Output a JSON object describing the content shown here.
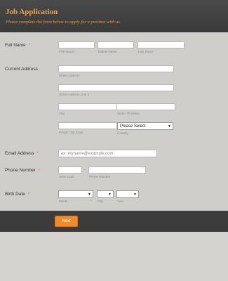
{
  "header": {
    "title": "Job Application",
    "subtitle": "Please complete the form below to apply for a position with us."
  },
  "full_name": {
    "label": "Full Name",
    "required_mark": "*",
    "first_sub": "First Name",
    "middle_sub": "Middle Name",
    "last_sub": "Last Name"
  },
  "address": {
    "label": "Current Address",
    "street_sub": "Street Address",
    "street2_sub": "Street Address Line 2",
    "city_sub": "City",
    "state_sub": "State / Province",
    "postal_sub": "Postal / Zip Code",
    "country_sub": "Country",
    "country_value": "Please Select"
  },
  "email": {
    "label": "Email Address",
    "required_mark": "*",
    "placeholder": "ex: myname@example.com"
  },
  "phone": {
    "label": "Phone Number",
    "required_mark": "*",
    "separator": "-",
    "area_sub": "Area Code",
    "number_sub": "Phone Number"
  },
  "birth": {
    "label": "Birth Date",
    "required_mark": "*",
    "month_sub": "Month",
    "day_sub": "Day",
    "year_sub": "Year"
  },
  "footer": {
    "next_label": "Next"
  },
  "colors": {
    "accent": "#f08a2e",
    "header_bg": "#3c3c3c",
    "page_bg": "#d5d3cf"
  }
}
